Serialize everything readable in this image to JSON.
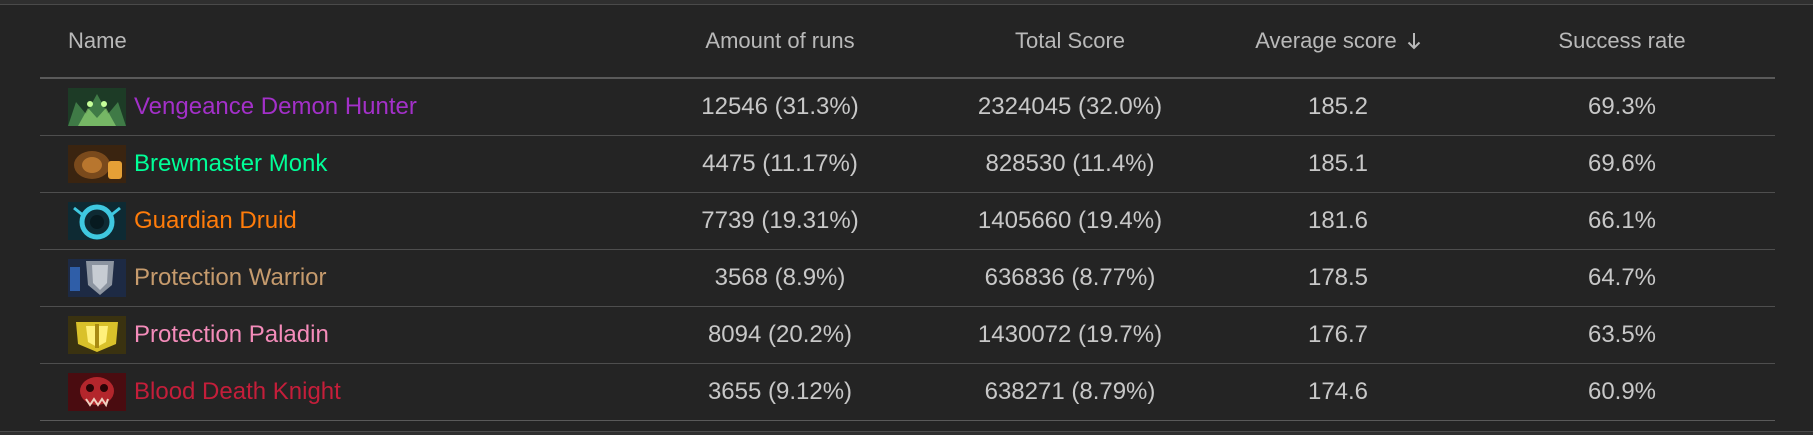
{
  "columns": {
    "name": "Name",
    "runs": "Amount of runs",
    "score": "Total Score",
    "avg": "Average score",
    "rate": "Success rate"
  },
  "sort": {
    "column": "avg",
    "direction": "descending",
    "icon": "arrow-down-icon"
  },
  "rows": [
    {
      "name": "Vengeance Demon Hunter",
      "color": "#a330c9",
      "icon": "vengeance-demon-hunter-icon",
      "runs": "12546 (31.3%)",
      "score": "2324045 (32.0%)",
      "avg": "185.2",
      "rate": "69.3%"
    },
    {
      "name": "Brewmaster Monk",
      "color": "#00ff98",
      "icon": "brewmaster-monk-icon",
      "runs": "4475 (11.17%)",
      "score": "828530 (11.4%)",
      "avg": "185.1",
      "rate": "69.6%"
    },
    {
      "name": "Guardian Druid",
      "color": "#ff7c0a",
      "icon": "guardian-druid-icon",
      "runs": "7739 (19.31%)",
      "score": "1405660 (19.4%)",
      "avg": "181.6",
      "rate": "66.1%"
    },
    {
      "name": "Protection Warrior",
      "color": "#c69b6d",
      "icon": "protection-warrior-icon",
      "runs": "3568 (8.9%)",
      "score": "636836 (8.77%)",
      "avg": "178.5",
      "rate": "64.7%"
    },
    {
      "name": "Protection Paladin",
      "color": "#f48cba",
      "icon": "protection-paladin-icon",
      "runs": "8094 (20.2%)",
      "score": "1430072 (19.7%)",
      "avg": "176.7",
      "rate": "63.5%"
    },
    {
      "name": "Blood Death Knight",
      "color": "#c41e3a",
      "icon": "blood-death-knight-icon",
      "runs": "3655 (9.12%)",
      "score": "638271 (8.79%)",
      "avg": "174.6",
      "rate": "60.9%"
    }
  ]
}
